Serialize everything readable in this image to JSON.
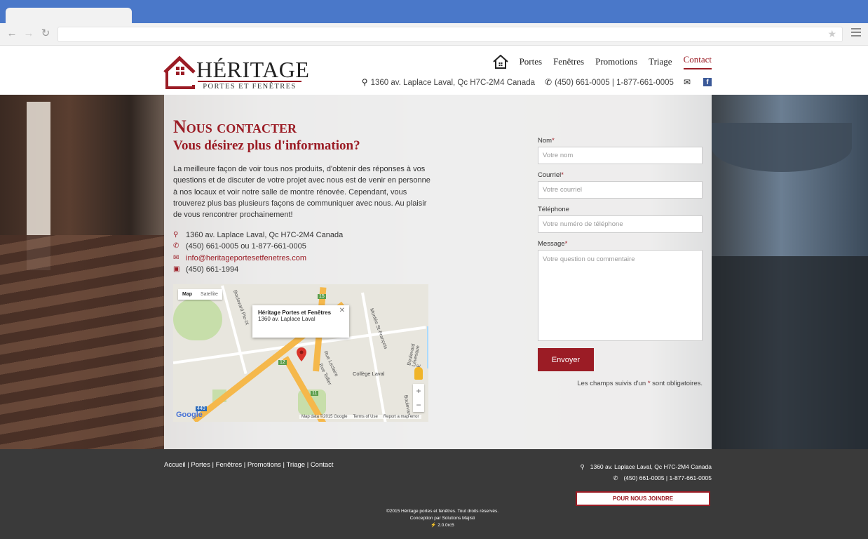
{
  "header": {
    "logo_title": "HÉRITAGE",
    "logo_sub": "PORTES ET FENÊTRES",
    "nav": [
      {
        "label": "Portes"
      },
      {
        "label": "Fenêtres"
      },
      {
        "label": "Promotions"
      },
      {
        "label": "Triage"
      },
      {
        "label": "Contact"
      }
    ],
    "address": "1360 av. Laplace Laval, Qc H7C-2M4 Canada",
    "phone": "(450) 661-0005 | 1-877-661-0005"
  },
  "content": {
    "title": "Nous contacter",
    "subtitle": "Vous désirez plus d'information?",
    "intro": "La meilleure façon de voir tous nos produits, d'obtenir des réponses à vos questions et de discuter de votre projet avec nous est de venir en personne à nos locaux et voir notre salle de montre rénovée. Cependant, vous trouverez plus bas plusieurs façons de communiquer avec nous. Au plaisir de vous rencontrer prochainement!",
    "info": {
      "address": "1360 av. Laplace Laval, Qc H7C-2M4 Canada",
      "phone": "(450) 661-0005 ou 1-877-661-0005",
      "email": "info@heritageportesetfenetres.com",
      "fax": "(450) 661-1994"
    }
  },
  "map": {
    "tab_map": "Map",
    "tab_satellite": "Satellite",
    "info_title": "Héritage Portes et Fenêtres",
    "info_address": "1360 av. Laplace Laval",
    "close": "✕",
    "labels": {
      "boulevard_pie": "Boulevard Pie-IX",
      "montee": "Montée St-François",
      "boulevard_lev": "Boulevard Lévesque E",
      "rue_leclaire": "Rue Leclaire",
      "rue_tellier": "Rue Tellier",
      "college": "Collège Laval",
      "boulevard": "Boulevard",
      "r15": "15",
      "r12": "12",
      "r11": "11",
      "r440": "440"
    },
    "footer": [
      "Map data ©2015 Google",
      "Terms of Use",
      "Report a map error"
    ],
    "google": "Google",
    "zoom_in": "+",
    "zoom_out": "−"
  },
  "form": {
    "name_label": "Nom",
    "name_placeholder": "Votre nom",
    "email_label": "Courriel",
    "email_placeholder": "Votre courriel",
    "phone_label": "Téléphone",
    "phone_placeholder": "Votre numéro de téléphone",
    "message_label": "Message",
    "message_placeholder": "Votre question ou commentaire",
    "required_mark": "*",
    "submit": "Envoyer",
    "note_before": "Les champs suivis d'un",
    "note_after": "sont obligatoires."
  },
  "footer": {
    "links": [
      "Accueil",
      "Portes",
      "Fenêtres",
      "Promotions",
      "Triage",
      "Contact"
    ],
    "separator": " | ",
    "address": "1360 av. Laplace Laval, Qc H7C-2M4 Canada",
    "phone": "(450) 661-0005 | 1-877-661-0005",
    "join": "POUR NOUS JOINDRE",
    "copyright": "©2015 Héritage portes et fenêtres. Tout droits réservés.",
    "credit": "Conception par Solutions Majisti",
    "version": "2.0.0rc5"
  },
  "colors": {
    "brand": "#9b1c25",
    "chrome": "#4a78c9",
    "footer": "#3a3a3a"
  },
  "icons": [
    "back-icon",
    "forward-icon",
    "reload-icon",
    "star-icon",
    "menu-icon",
    "home-icon",
    "map-marker-icon",
    "phone-icon",
    "envelope-icon",
    "fax-icon",
    "facebook-icon"
  ]
}
